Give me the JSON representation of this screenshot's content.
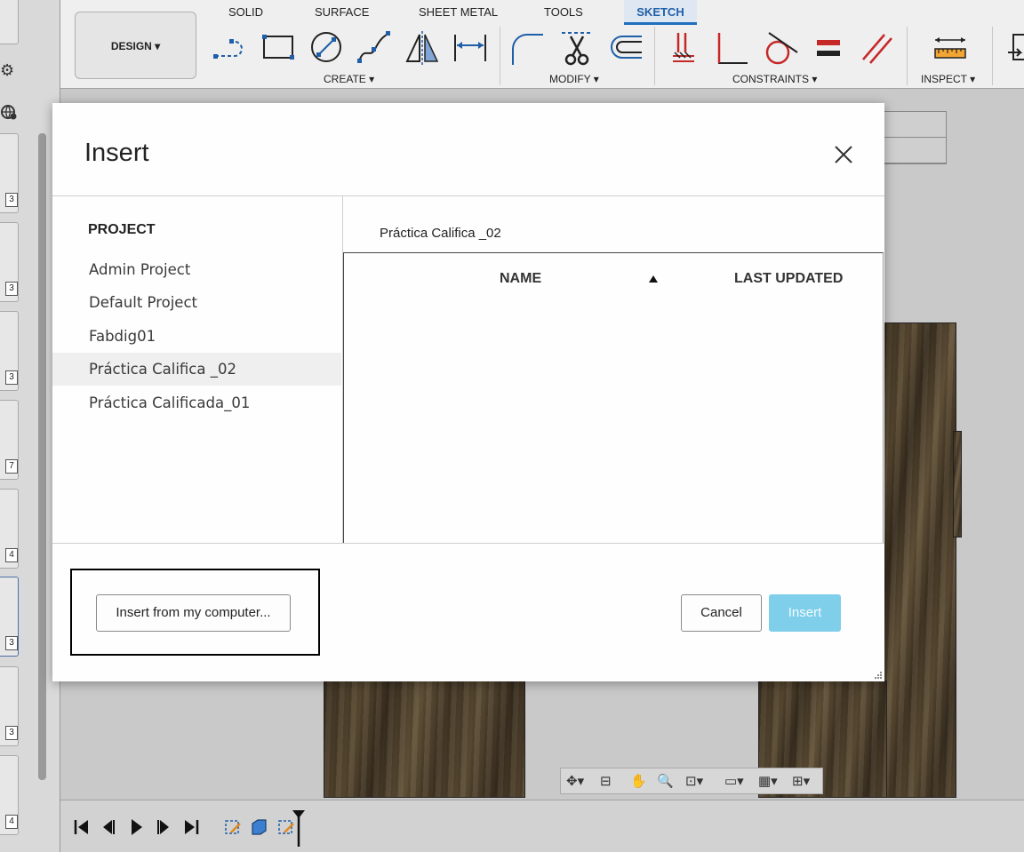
{
  "toolbar": {
    "tabs": [
      "SOLID",
      "SURFACE",
      "SHEET METAL",
      "TOOLS",
      "SKETCH"
    ],
    "workspace_label": "DESIGN ▾",
    "groups": [
      "CREATE ▾",
      "MODIFY ▾",
      "CONSTRAINTS ▾",
      "INSPECT ▾"
    ]
  },
  "left_strip": {
    "badges": [
      "3",
      "3",
      "3",
      "7",
      "4",
      "3",
      "3",
      "4"
    ]
  },
  "modal": {
    "title": "Insert",
    "project_heading": "PROJECT",
    "projects": [
      "Admin Project",
      "Default Project",
      "Fabdig01",
      "Práctica Califica _02",
      "Práctica Calificada_01"
    ],
    "selected_project": "Práctica Califica _02",
    "current_path": "Práctica Califica _02",
    "columns": {
      "name": "NAME",
      "last_updated": "LAST UPDATED"
    },
    "buttons": {
      "insert_local": "Insert from my computer...",
      "cancel": "Cancel",
      "insert": "Insert"
    }
  },
  "colors": {
    "accent": "#1f6fbf",
    "insert_disabled": "#7fcfeb",
    "selection": "#efefef"
  }
}
